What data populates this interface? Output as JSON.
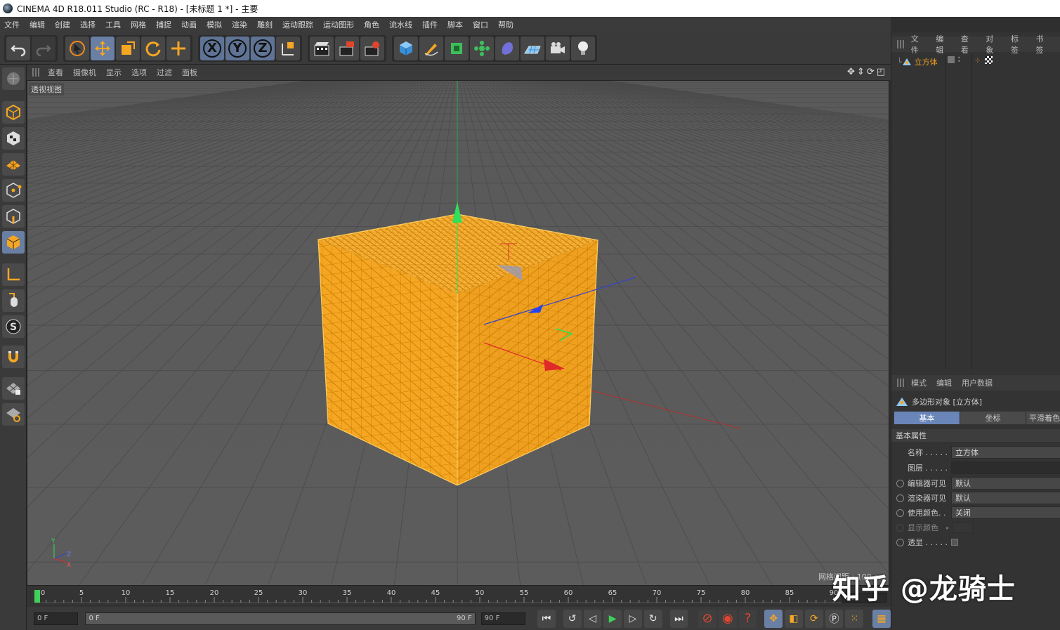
{
  "window": {
    "title": "CINEMA 4D R18.011 Studio (RC - R18) - [未标题 1 *] - 主要"
  },
  "menu": [
    "文件",
    "编辑",
    "创建",
    "选择",
    "工具",
    "网格",
    "捕捉",
    "动画",
    "模拟",
    "渲染",
    "雕刻",
    "运动跟踪",
    "运动图形",
    "角色",
    "流水线",
    "插件",
    "脚本",
    "窗口",
    "帮助"
  ],
  "toolbar": {
    "axis_x": "X",
    "axis_y": "Y",
    "axis_z": "Z",
    "icons": [
      "undo-icon",
      "redo-icon",
      "select-icon",
      "move-icon",
      "scale-icon",
      "rotate-icon",
      "transform-icon",
      "coord-icon",
      "render-view-icon",
      "render-picture-icon",
      "render-settings-icon",
      "cube-primitive-icon",
      "pen-icon",
      "subdivision-icon",
      "cloner-icon",
      "deformer-icon",
      "floor-icon",
      "camera-icon",
      "light-icon"
    ]
  },
  "viewport": {
    "menu": [
      "查看",
      "摄像机",
      "显示",
      "选项",
      "过滤",
      "面板"
    ],
    "label": "透视视图",
    "grid_info": "网格间距 : 100 cm",
    "axis_gizmo": {
      "y": "Y",
      "z": "Z",
      "x": "X"
    }
  },
  "timeline": {
    "ticks": [
      "0",
      "5",
      "10",
      "15",
      "20",
      "25",
      "30",
      "35",
      "40",
      "45",
      "50",
      "55",
      "60",
      "65",
      "70",
      "75",
      "80",
      "85",
      "90"
    ],
    "end_field": "0 F"
  },
  "transport": {
    "current_frame": "0 F",
    "range_start": "0 F",
    "range_end": "90 F",
    "max_frame": "90 F"
  },
  "object_manager": {
    "menu": [
      "文件",
      "编辑",
      "查看",
      "对象",
      "标签",
      "书签"
    ],
    "objects": [
      {
        "name": "立方体"
      }
    ]
  },
  "attribute_manager": {
    "menu": [
      "模式",
      "编辑",
      "用户数据"
    ],
    "title": "多边形对象 [立方体]",
    "tabs": [
      "基本",
      "坐标",
      "平滑着色"
    ],
    "section": "基本属性",
    "props": {
      "name_label": "名称 . . . . .",
      "name_value": "立方体",
      "layer_label": "图层 . . . . .",
      "layer_value": "",
      "editor_vis_label": "编辑器可见",
      "editor_vis_value": "默认",
      "render_vis_label": "渲染器可见",
      "render_vis_value": "默认",
      "use_color_label": "使用颜色. .",
      "use_color_value": "关闭",
      "display_color_label": "显示颜色",
      "xray_label": "透显 . . . . ."
    }
  },
  "watermark": "知乎 @龙骑士",
  "colors": {
    "selection": "#f5a623",
    "active_blue": "#6a86b8",
    "bg": "#333333"
  }
}
